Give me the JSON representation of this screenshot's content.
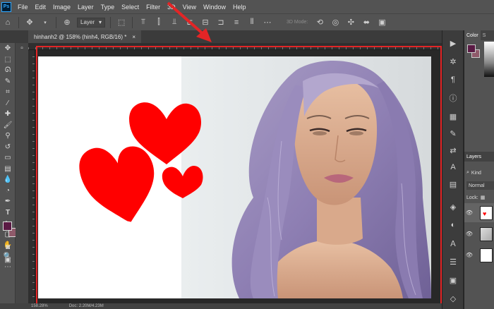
{
  "app": {
    "logo_text": "Ps"
  },
  "menu": [
    "File",
    "Edit",
    "Image",
    "Layer",
    "Type",
    "Select",
    "Filter",
    "3D",
    "View",
    "Window",
    "Help"
  ],
  "options_bar": {
    "layer_select": "Layer",
    "mode_3d_label": "3D Mode:"
  },
  "document_tab": {
    "title": "hinhanh2 @ 158% (hinh4, RGB/16) *",
    "close": "×"
  },
  "right_panel": {
    "tab_color": "Color",
    "tab_swatches": "S",
    "layers_tab": "Layers",
    "kind_label": "Kind",
    "blend_mode": "Normal",
    "lock_label": "Lock:"
  },
  "colors": {
    "foreground": "#5a1a44",
    "background": "#8f5a6a",
    "highlight": "#e32526",
    "heart": "#ff0000"
  },
  "canvas": {
    "hearts": 3
  },
  "status": {
    "zoom": "158.28%",
    "doc_size": "Doc: 2.20M/4.23M"
  }
}
